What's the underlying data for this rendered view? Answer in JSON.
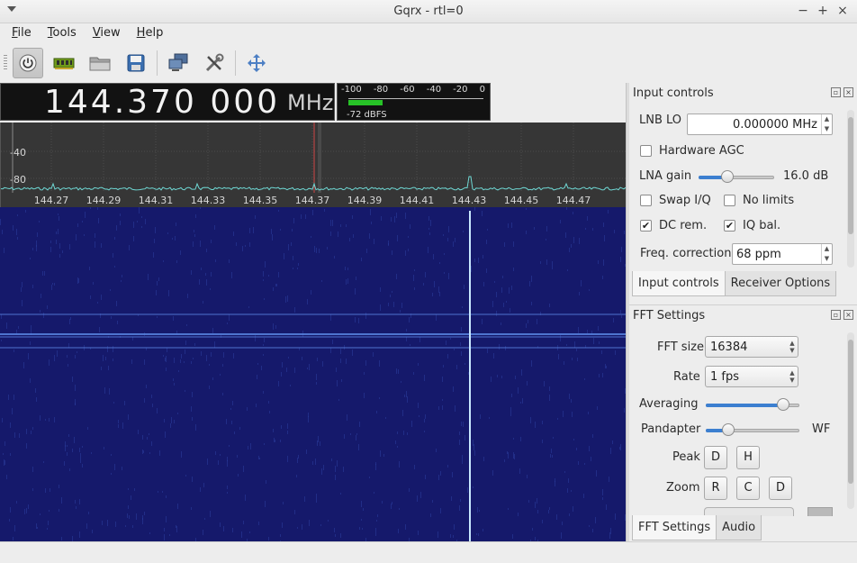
{
  "window": {
    "title": "Gqrx  - rtl=0",
    "buttons": [
      "−",
      "+",
      "×"
    ]
  },
  "menu": {
    "items": [
      {
        "ul": "F",
        "rest": "ile"
      },
      {
        "ul": "T",
        "rest": "ools"
      },
      {
        "ul": "V",
        "rest": "iew"
      },
      {
        "ul": "H",
        "rest": "elp"
      }
    ]
  },
  "toolbar": {
    "buttons": [
      "power-icon",
      "hardware-icon",
      "open-folder-icon",
      "save-icon",
      "network-icon",
      "settings-tools-icon",
      "move-arrows-icon"
    ]
  },
  "frequency": {
    "value": "144.370 000",
    "unit": "MHz"
  },
  "signal_meter": {
    "scale": [
      "-100",
      "-80",
      "-60",
      "-40",
      "-20",
      "0"
    ],
    "level_text": "-72 dBFS",
    "level_fraction": 0.25
  },
  "spectrum": {
    "y_labels": [
      "-40",
      "-80"
    ],
    "x_labels": [
      "144.27",
      "144.29",
      "144.31",
      "144.33",
      "144.35",
      "144.37",
      "144.39",
      "144.41",
      "144.43",
      "144.45",
      "144.47"
    ],
    "colors": {
      "background": "#363636",
      "trace": "#6fd8d4",
      "marker": "#d04545"
    }
  },
  "waterfall": {
    "colors": {
      "background": "#15196b",
      "signal": "#c8e8ff"
    }
  },
  "input_controls": {
    "title": "Input controls",
    "lnb_lo_label": "LNB LO",
    "lnb_lo_value": "0.000000 MHz",
    "hw_agc_label": "Hardware AGC",
    "hw_agc_checked": false,
    "lna_gain_label": "LNA gain",
    "lna_gain_value": "16.0 dB",
    "lna_gain_fraction": 0.35,
    "swap_iq_label": "Swap I/Q",
    "swap_iq_checked": false,
    "no_limits_label": "No limits",
    "no_limits_checked": false,
    "dc_rem_label": "DC rem.",
    "dc_rem_checked": true,
    "iq_bal_label": "IQ bal.",
    "iq_bal_checked": true,
    "freq_corr_label": "Freq. correction",
    "freq_corr_value": "68 ppm",
    "tabs": [
      "Input controls",
      "Receiver Options"
    ]
  },
  "fft_settings": {
    "title": "FFT Settings",
    "fft_size_label": "FFT size",
    "fft_size_value": "16384",
    "rate_label": "Rate",
    "rate_value": "1 fps",
    "averaging_label": "Averaging",
    "averaging_fraction": 0.88,
    "pandapter_label": "Pandapter",
    "pandapter_fraction": 0.2,
    "wf_label": "WF",
    "peak_label": "Peak",
    "peak_buttons": [
      "D",
      "H"
    ],
    "zoom_label": "Zoom",
    "zoom_buttons": [
      "R",
      "C",
      "D"
    ],
    "tabs": [
      "FFT Settings",
      "Audio"
    ]
  }
}
